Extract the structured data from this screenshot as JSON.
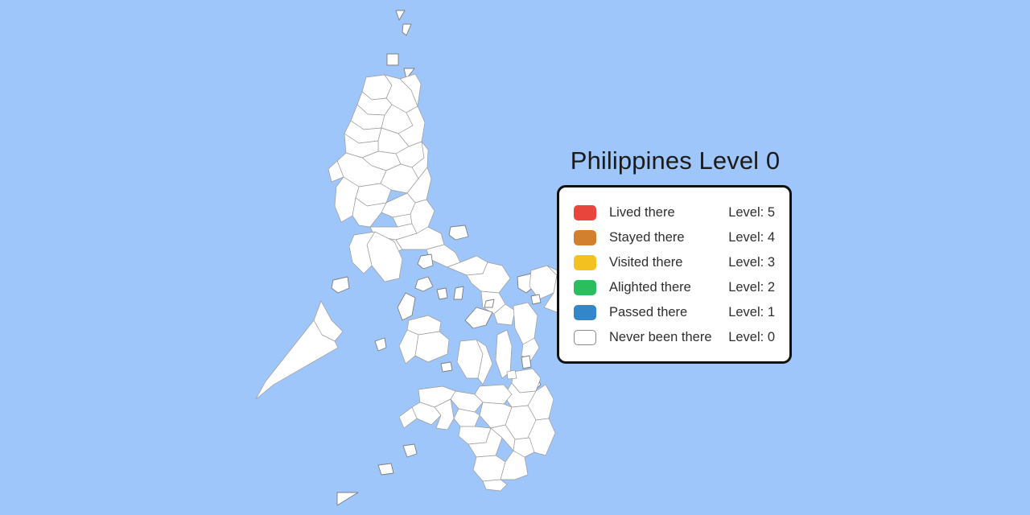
{
  "background_color": "#9fc6fa",
  "title": "Philippines Level 0",
  "map": {
    "land_fill": "#ffffff",
    "border_color": "#9a9a9a",
    "water_color": "#9fc6fa",
    "country": "Philippines",
    "fill_level": 0
  },
  "legend": {
    "border_color": "#111111",
    "background_color": "#ffffff",
    "rows": [
      {
        "label": "Lived there",
        "level_text": "Level: 5",
        "color": "#e8453c",
        "level": 5
      },
      {
        "label": "Stayed there",
        "level_text": "Level: 4",
        "color": "#d2802e",
        "level": 4
      },
      {
        "label": "Visited there",
        "level_text": "Level: 3",
        "color": "#f4c220",
        "level": 3
      },
      {
        "label": "Alighted there",
        "level_text": "Level: 2",
        "color": "#2bbe5e",
        "level": 2
      },
      {
        "label": "Passed there",
        "level_text": "Level: 1",
        "color": "#3387c8",
        "level": 1
      },
      {
        "label": "Never been there",
        "level_text": "Level: 0",
        "color": "#ffffff",
        "level": 0
      }
    ]
  }
}
